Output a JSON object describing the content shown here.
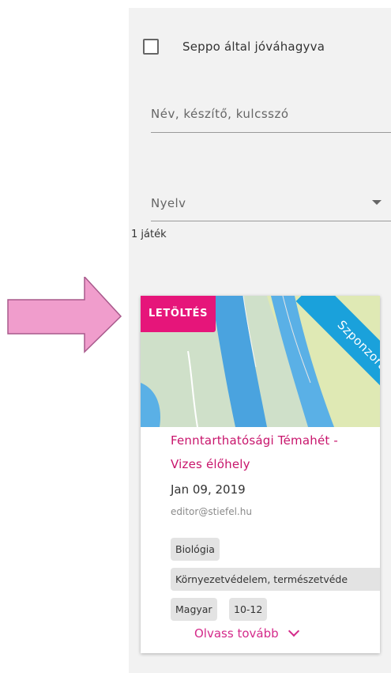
{
  "filters": {
    "approved_checkbox_label": "Seppo által jóváhagyva",
    "approved_checked": false,
    "search_placeholder": "Név, készítő, kulcsszó",
    "language_label": "Nyelv"
  },
  "result_count": "1 játék",
  "card": {
    "badge": "LETÖLTÉS",
    "ribbon": "Szponzorált",
    "title_line1": "Fenntarthatósági Témahét -",
    "title_line2": "Vizes élőhely",
    "date": "Jan 09, 2019",
    "author": "editor@stiefel.hu",
    "tags": [
      "Biológia",
      "Környezetvédelem, természetvéde",
      "Magyar",
      "10-12"
    ],
    "read_more": "Olvass tovább"
  },
  "colors": {
    "badge_pink": "#e6157a",
    "ribbon_blue": "#1aa1db",
    "title_pink": "#c8156c",
    "arrow_pink": "#f09dcc",
    "panel_bg": "#f2f2f2"
  },
  "icons": [
    "checkbox-icon",
    "dropdown-arrow-icon",
    "chevron-down-icon",
    "pointer-arrow-icon"
  ]
}
